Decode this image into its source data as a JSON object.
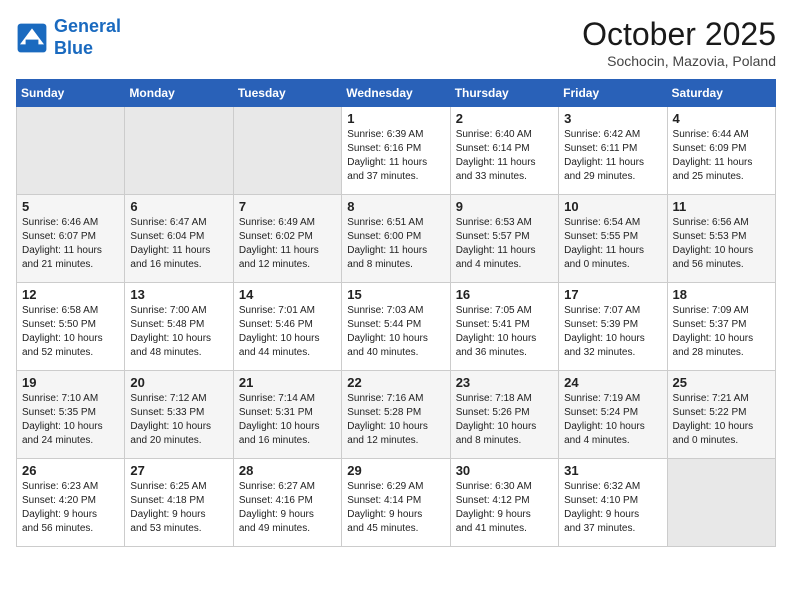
{
  "logo": {
    "line1": "General",
    "line2": "Blue"
  },
  "title": "October 2025",
  "subtitle": "Sochocin, Mazovia, Poland",
  "days_header": [
    "Sunday",
    "Monday",
    "Tuesday",
    "Wednesday",
    "Thursday",
    "Friday",
    "Saturday"
  ],
  "weeks": [
    [
      {
        "day": "",
        "info": ""
      },
      {
        "day": "",
        "info": ""
      },
      {
        "day": "",
        "info": ""
      },
      {
        "day": "1",
        "info": "Sunrise: 6:39 AM\nSunset: 6:16 PM\nDaylight: 11 hours\nand 37 minutes."
      },
      {
        "day": "2",
        "info": "Sunrise: 6:40 AM\nSunset: 6:14 PM\nDaylight: 11 hours\nand 33 minutes."
      },
      {
        "day": "3",
        "info": "Sunrise: 6:42 AM\nSunset: 6:11 PM\nDaylight: 11 hours\nand 29 minutes."
      },
      {
        "day": "4",
        "info": "Sunrise: 6:44 AM\nSunset: 6:09 PM\nDaylight: 11 hours\nand 25 minutes."
      }
    ],
    [
      {
        "day": "5",
        "info": "Sunrise: 6:46 AM\nSunset: 6:07 PM\nDaylight: 11 hours\nand 21 minutes."
      },
      {
        "day": "6",
        "info": "Sunrise: 6:47 AM\nSunset: 6:04 PM\nDaylight: 11 hours\nand 16 minutes."
      },
      {
        "day": "7",
        "info": "Sunrise: 6:49 AM\nSunset: 6:02 PM\nDaylight: 11 hours\nand 12 minutes."
      },
      {
        "day": "8",
        "info": "Sunrise: 6:51 AM\nSunset: 6:00 PM\nDaylight: 11 hours\nand 8 minutes."
      },
      {
        "day": "9",
        "info": "Sunrise: 6:53 AM\nSunset: 5:57 PM\nDaylight: 11 hours\nand 4 minutes."
      },
      {
        "day": "10",
        "info": "Sunrise: 6:54 AM\nSunset: 5:55 PM\nDaylight: 11 hours\nand 0 minutes."
      },
      {
        "day": "11",
        "info": "Sunrise: 6:56 AM\nSunset: 5:53 PM\nDaylight: 10 hours\nand 56 minutes."
      }
    ],
    [
      {
        "day": "12",
        "info": "Sunrise: 6:58 AM\nSunset: 5:50 PM\nDaylight: 10 hours\nand 52 minutes."
      },
      {
        "day": "13",
        "info": "Sunrise: 7:00 AM\nSunset: 5:48 PM\nDaylight: 10 hours\nand 48 minutes."
      },
      {
        "day": "14",
        "info": "Sunrise: 7:01 AM\nSunset: 5:46 PM\nDaylight: 10 hours\nand 44 minutes."
      },
      {
        "day": "15",
        "info": "Sunrise: 7:03 AM\nSunset: 5:44 PM\nDaylight: 10 hours\nand 40 minutes."
      },
      {
        "day": "16",
        "info": "Sunrise: 7:05 AM\nSunset: 5:41 PM\nDaylight: 10 hours\nand 36 minutes."
      },
      {
        "day": "17",
        "info": "Sunrise: 7:07 AM\nSunset: 5:39 PM\nDaylight: 10 hours\nand 32 minutes."
      },
      {
        "day": "18",
        "info": "Sunrise: 7:09 AM\nSunset: 5:37 PM\nDaylight: 10 hours\nand 28 minutes."
      }
    ],
    [
      {
        "day": "19",
        "info": "Sunrise: 7:10 AM\nSunset: 5:35 PM\nDaylight: 10 hours\nand 24 minutes."
      },
      {
        "day": "20",
        "info": "Sunrise: 7:12 AM\nSunset: 5:33 PM\nDaylight: 10 hours\nand 20 minutes."
      },
      {
        "day": "21",
        "info": "Sunrise: 7:14 AM\nSunset: 5:31 PM\nDaylight: 10 hours\nand 16 minutes."
      },
      {
        "day": "22",
        "info": "Sunrise: 7:16 AM\nSunset: 5:28 PM\nDaylight: 10 hours\nand 12 minutes."
      },
      {
        "day": "23",
        "info": "Sunrise: 7:18 AM\nSunset: 5:26 PM\nDaylight: 10 hours\nand 8 minutes."
      },
      {
        "day": "24",
        "info": "Sunrise: 7:19 AM\nSunset: 5:24 PM\nDaylight: 10 hours\nand 4 minutes."
      },
      {
        "day": "25",
        "info": "Sunrise: 7:21 AM\nSunset: 5:22 PM\nDaylight: 10 hours\nand 0 minutes."
      }
    ],
    [
      {
        "day": "26",
        "info": "Sunrise: 6:23 AM\nSunset: 4:20 PM\nDaylight: 9 hours\nand 56 minutes."
      },
      {
        "day": "27",
        "info": "Sunrise: 6:25 AM\nSunset: 4:18 PM\nDaylight: 9 hours\nand 53 minutes."
      },
      {
        "day": "28",
        "info": "Sunrise: 6:27 AM\nSunset: 4:16 PM\nDaylight: 9 hours\nand 49 minutes."
      },
      {
        "day": "29",
        "info": "Sunrise: 6:29 AM\nSunset: 4:14 PM\nDaylight: 9 hours\nand 45 minutes."
      },
      {
        "day": "30",
        "info": "Sunrise: 6:30 AM\nSunset: 4:12 PM\nDaylight: 9 hours\nand 41 minutes."
      },
      {
        "day": "31",
        "info": "Sunrise: 6:32 AM\nSunset: 4:10 PM\nDaylight: 9 hours\nand 37 minutes."
      },
      {
        "day": "",
        "info": ""
      }
    ]
  ]
}
